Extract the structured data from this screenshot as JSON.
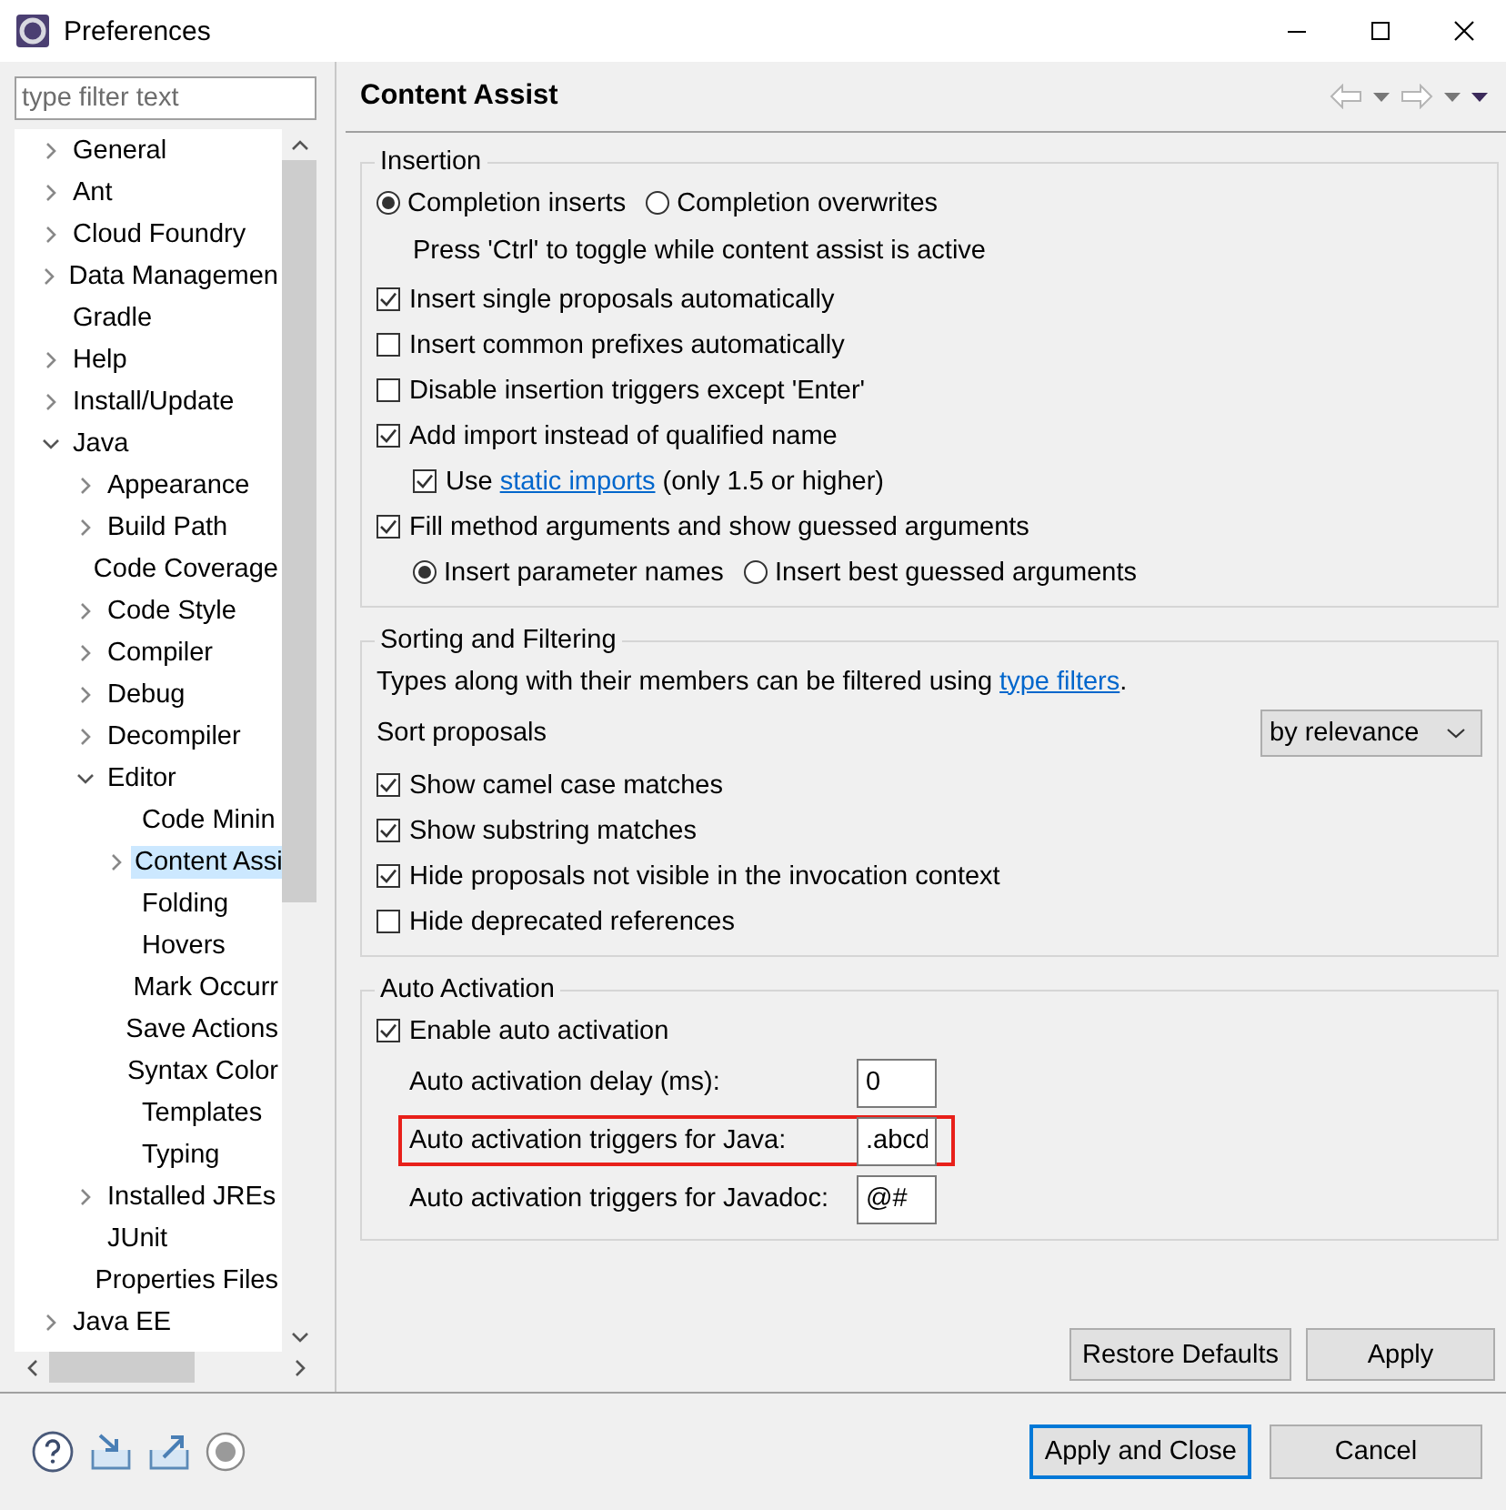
{
  "window": {
    "title": "Preferences"
  },
  "filter": {
    "placeholder": "type filter text"
  },
  "tree": [
    {
      "label": "General",
      "expanded": false,
      "selected": false
    },
    {
      "label": "Ant",
      "expanded": false,
      "selected": false
    },
    {
      "label": "Cloud Foundry",
      "expanded": false,
      "selected": false
    },
    {
      "label": "Data Managemen",
      "expanded": false,
      "selected": false
    },
    {
      "label": "Gradle",
      "selected": false
    },
    {
      "label": "Help",
      "expanded": false,
      "selected": false
    },
    {
      "label": "Install/Update",
      "expanded": false,
      "selected": false
    },
    {
      "label": "Java",
      "expanded": true,
      "selected": false,
      "children": [
        {
          "label": "Appearance",
          "expanded": false,
          "selected": false
        },
        {
          "label": "Build Path",
          "expanded": false,
          "selected": false
        },
        {
          "label": "Code Coverage",
          "selected": false
        },
        {
          "label": "Code Style",
          "expanded": false,
          "selected": false
        },
        {
          "label": "Compiler",
          "expanded": false,
          "selected": false
        },
        {
          "label": "Debug",
          "expanded": false,
          "selected": false
        },
        {
          "label": "Decompiler",
          "expanded": false,
          "selected": false
        },
        {
          "label": "Editor",
          "expanded": true,
          "selected": false,
          "children": [
            {
              "label": "Code Minin",
              "selected": false
            },
            {
              "label": "Content Assi",
              "expanded": false,
              "selected": true
            },
            {
              "label": "Folding",
              "selected": false
            },
            {
              "label": "Hovers",
              "selected": false
            },
            {
              "label": "Mark Occurr",
              "selected": false
            },
            {
              "label": "Save Actions",
              "selected": false
            },
            {
              "label": "Syntax Color",
              "selected": false
            },
            {
              "label": "Templates",
              "selected": false
            },
            {
              "label": "Typing",
              "selected": false
            }
          ]
        },
        {
          "label": "Installed JREs",
          "expanded": false,
          "selected": false
        },
        {
          "label": "JUnit",
          "selected": false
        },
        {
          "label": "Properties Files",
          "selected": false
        }
      ]
    },
    {
      "label": "Java EE",
      "expanded": false,
      "selected": false
    }
  ],
  "page": {
    "title": "Content Assist"
  },
  "groups": [
    {
      "title": "Insertion",
      "rows": [
        {
          "kind": "radios",
          "indented": false,
          "options": [
            {
              "label": "Completion inserts",
              "selected": true
            },
            {
              "label": "Completion overwrites",
              "selected": false
            }
          ]
        },
        {
          "kind": "note",
          "text": "Press 'Ctrl' to toggle while content assist is active"
        },
        {
          "kind": "checkbox",
          "indented": false,
          "checked": true,
          "label": "Insert single proposals automatically"
        },
        {
          "kind": "checkbox",
          "indented": false,
          "checked": false,
          "label": "Insert common prefixes automatically"
        },
        {
          "kind": "checkbox",
          "indented": false,
          "checked": false,
          "label": "Disable insertion triggers except 'Enter'"
        },
        {
          "kind": "checkbox",
          "indented": false,
          "checked": true,
          "label": "Add import instead of qualified name"
        },
        {
          "kind": "checkbox",
          "indented": true,
          "checked": true,
          "label": "Use ",
          "link": "static imports",
          "label_after": " (only 1.5 or higher)"
        },
        {
          "kind": "checkbox",
          "indented": false,
          "checked": true,
          "label": "Fill method arguments and show guessed arguments"
        },
        {
          "kind": "radios",
          "indented": true,
          "options": [
            {
              "label": "Insert parameter names",
              "selected": true
            },
            {
              "label": "Insert best guessed arguments",
              "selected": false
            }
          ]
        }
      ]
    },
    {
      "title": "Sorting and Filtering",
      "rows": [
        {
          "kind": "text",
          "text": "Types along with their members can be filtered using ",
          "link": "type filters",
          "text_after": "."
        },
        {
          "kind": "select",
          "label": "Sort proposals",
          "value": "by relevance"
        },
        {
          "kind": "checkbox",
          "indented": false,
          "checked": true,
          "label": "Show camel case matches"
        },
        {
          "kind": "checkbox",
          "indented": false,
          "checked": true,
          "label": "Show substring matches"
        },
        {
          "kind": "checkbox",
          "indented": false,
          "checked": true,
          "label": "Hide proposals not visible in the invocation context"
        },
        {
          "kind": "checkbox",
          "indented": false,
          "checked": false,
          "label": "Hide deprecated references"
        }
      ]
    },
    {
      "title": "Auto Activation",
      "rows": [
        {
          "kind": "checkbox",
          "indented": false,
          "checked": true,
          "label": "Enable auto activation"
        },
        {
          "kind": "field",
          "label": "Auto activation delay (ms):",
          "value": "0",
          "highlighted": false
        },
        {
          "kind": "field",
          "label": "Auto activation triggers for Java:",
          "value": ".abcd",
          "highlighted": true
        },
        {
          "kind": "field",
          "label": "Auto activation triggers for Javadoc:",
          "value": "@#",
          "highlighted": false
        }
      ]
    }
  ],
  "page_buttons": [
    "Restore Defaults",
    "Apply"
  ],
  "dialog_buttons": [
    {
      "label": "Apply and Close",
      "default": true
    },
    {
      "label": "Cancel",
      "default": false
    }
  ]
}
